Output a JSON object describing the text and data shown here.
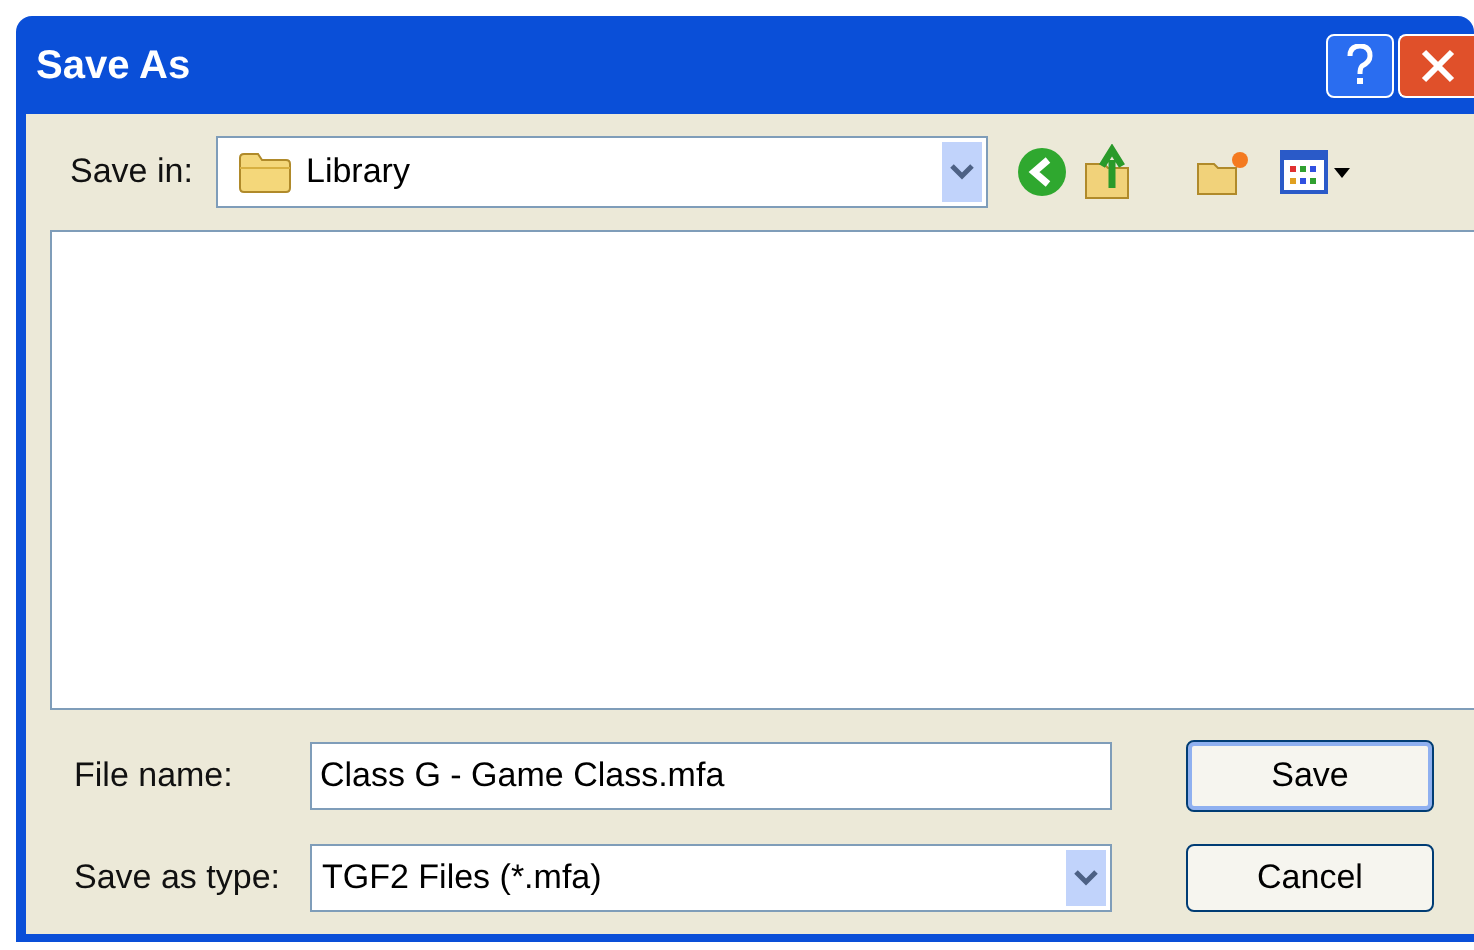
{
  "window": {
    "title": "Save As"
  },
  "toolbar": {
    "label": "Save in:",
    "location": "Library"
  },
  "file_name": {
    "label": "File name:",
    "value": "Class G - Game Class.mfa"
  },
  "file_type": {
    "label": "Save as type:",
    "value": "TGF2 Files (*.mfa)"
  },
  "buttons": [
    {
      "label": "Save",
      "default": true
    },
    {
      "label": "Cancel",
      "default": false
    }
  ]
}
